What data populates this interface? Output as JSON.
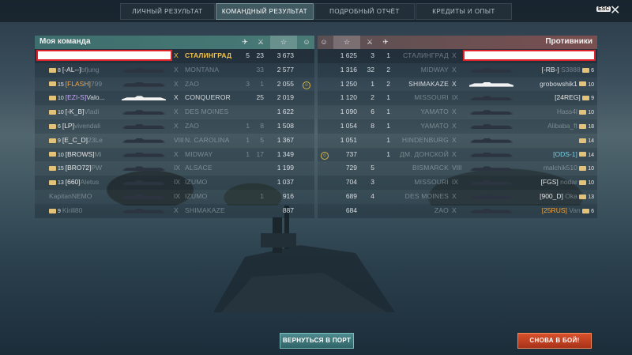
{
  "tabs": [
    {
      "label": "ЛИЧНЫЙ РЕЗУЛЬТАТ",
      "active": false
    },
    {
      "label": "КОМАНДНЫЙ РЕЗУЛЬТАТ",
      "active": true
    },
    {
      "label": "ПОДРОБНЫЙ ОТЧЁТ",
      "active": false
    },
    {
      "label": "КРЕДИТЫ И ОПЫТ",
      "active": false
    }
  ],
  "esc_label": "ESC",
  "close_glyph": "✕",
  "my_team": {
    "title": "Моя команда",
    "header_icons": [
      "plane-kill-icon",
      "ship-kill-icon",
      "star-icon",
      "medal-icon"
    ],
    "rows": [
      {
        "player": "",
        "clan": "",
        "tier": "X",
        "ship": "СТАЛИНГРАД",
        "planes": "5",
        "kills": "23",
        "xp": "3 673",
        "medal": "",
        "highlight": true,
        "alive": true
      },
      {
        "player": "bfjung",
        "clan": "[-AL--]",
        "clan_color": "white",
        "tier_badge": "8",
        "tier": "X",
        "ship": "MONTANA",
        "planes": "",
        "kills": "33",
        "xp": "2 577",
        "medal": "",
        "alive": false
      },
      {
        "player": "799",
        "clan": "[FLASH]",
        "clan_color": "orange",
        "tier_badge": "15",
        "tier": "X",
        "ship": "ZAO",
        "planes": "3",
        "kills": "1",
        "xp": "2 055",
        "medal": "medal",
        "alive": false
      },
      {
        "player": "Valo...",
        "clan": "[EZI-S]",
        "clan_color": "purple",
        "tier_badge": "10",
        "tier": "X",
        "ship": "CONQUEROR",
        "planes": "",
        "kills": "25",
        "xp": "2 019",
        "medal": "",
        "alive": true,
        "white_ship": true
      },
      {
        "player": "Vladi",
        "clan": "[-K_B]",
        "clan_color": "white",
        "tier_badge": "10",
        "tier": "X",
        "ship": "DES MOINES",
        "planes": "",
        "kills": "",
        "xp": "1 622",
        "medal": "",
        "alive": false
      },
      {
        "player": "vivendali",
        "clan": "[LP]",
        "clan_color": "white",
        "tier_badge": "6",
        "tier": "X",
        "ship": "ZAO",
        "planes": "1",
        "kills": "8",
        "xp": "1 508",
        "medal": "",
        "alive": false
      },
      {
        "player": "23Le",
        "clan": "[E_C_D]",
        "clan_color": "white",
        "tier_badge": "9",
        "tier": "VIII",
        "ship": "N. CAROLINA",
        "planes": "1",
        "kills": "5",
        "xp": "1 367",
        "medal": "",
        "alive": false
      },
      {
        "player": "Mi",
        "clan": "[BROWS]",
        "clan_color": "white",
        "tier_badge": "10",
        "tier": "X",
        "ship": "MIDWAY",
        "planes": "1",
        "kills": "17",
        "xp": "1 349",
        "medal": "",
        "alive": false
      },
      {
        "player": "PW",
        "clan": "[BRO72]",
        "clan_color": "white",
        "tier_badge": "15",
        "tier": "IX",
        "ship": "ALSACE",
        "planes": "",
        "kills": "",
        "xp": "1 199",
        "medal": "",
        "alive": false
      },
      {
        "player": "Aletus",
        "clan": "[660]",
        "clan_color": "white",
        "tier_badge": "13",
        "tier": "IX",
        "ship": "IZUMO",
        "planes": "",
        "kills": "",
        "xp": "1 037",
        "medal": "",
        "alive": false
      },
      {
        "player": "KapitanNEMO",
        "clan": "",
        "clan_color": "white",
        "tier_badge": "",
        "tier": "IX",
        "ship": "IZUMO",
        "planes": "",
        "kills": "1",
        "xp": "916",
        "medal": "",
        "alive": false
      },
      {
        "player": "Kirill80",
        "clan": "",
        "clan_color": "white",
        "tier_badge": "9",
        "tier": "X",
        "ship": "SHIMAKAZE",
        "planes": "",
        "kills": "",
        "xp": "887",
        "medal": "",
        "alive": false
      }
    ]
  },
  "enemy_team": {
    "title": "Противники",
    "header_icons": [
      "medal-icon",
      "star-icon",
      "ship-kill-icon",
      "plane-kill-icon"
    ],
    "rows": [
      {
        "player": "",
        "clan": "",
        "tier": "X",
        "ship": "СТАЛИНГРАД",
        "xp": "1 625",
        "kills": "3",
        "planes": "1",
        "medal": "",
        "highlight": true,
        "alive": false
      },
      {
        "player": "S3888",
        "clan": "[-RB-]",
        "clan_color": "white",
        "tier_badge": "6",
        "tier": "X",
        "ship": "MIDWAY",
        "xp": "1 316",
        "kills": "32",
        "planes": "2",
        "medal": "",
        "alive": false
      },
      {
        "player": "grobowshik1",
        "clan": "",
        "clan_color": "white",
        "tier_badge": "10",
        "tier": "X",
        "ship": "SHIMAKAZE",
        "xp": "1 250",
        "kills": "1",
        "planes": "2",
        "medal": "",
        "alive": true,
        "white_ship": true
      },
      {
        "player": "",
        "clan": "[24REG]",
        "clan_color": "white",
        "tier_badge": "9",
        "tier": "IX",
        "ship": "MISSOURI",
        "xp": "1 120",
        "kills": "2",
        "planes": "1",
        "medal": "",
        "alive": false
      },
      {
        "player": "Hass4l",
        "clan": "",
        "clan_color": "white",
        "tier_badge": "10",
        "tier": "X",
        "ship": "YAMATO",
        "xp": "1 090",
        "kills": "6",
        "planes": "1",
        "medal": "",
        "alive": false
      },
      {
        "player": "Alibaba_ft",
        "clan": "",
        "clan_color": "white",
        "tier_badge": "18",
        "tier": "X",
        "ship": "YAMATO",
        "xp": "1 054",
        "kills": "8",
        "planes": "1",
        "medal": "",
        "alive": false
      },
      {
        "player": "",
        "clan": "",
        "clan_color": "white",
        "tier_badge": "14",
        "tier": "X",
        "ship": "HINDENBURG",
        "xp": "1 051",
        "kills": "",
        "planes": "1",
        "medal": "",
        "alive": false
      },
      {
        "player": "",
        "clan": "[ODS-1]",
        "clan_color": "cyan",
        "tier_badge": "14",
        "tier": "X",
        "ship": "ДМ. ДОНСКОЙ",
        "xp": "737",
        "kills": "",
        "planes": "1",
        "medal": "medal",
        "alive": false
      },
      {
        "player": "malchik510",
        "clan": "",
        "clan_color": "white",
        "tier_badge": "10",
        "tier": "VIII",
        "ship": "BISMARCK",
        "xp": "729",
        "kills": "5",
        "planes": "",
        "medal": "",
        "alive": false
      },
      {
        "player": "nodar",
        "clan": "[FGS]",
        "clan_color": "white",
        "tier_badge": "10",
        "tier": "IX",
        "ship": "MISSOURI",
        "xp": "704",
        "kills": "3",
        "planes": "",
        "medal": "",
        "alive": false
      },
      {
        "player": "Oka",
        "clan": "[900_D]",
        "clan_color": "white",
        "tier_badge": "13",
        "tier": "X",
        "ship": "DES MOINES",
        "xp": "689",
        "kills": "4",
        "planes": "",
        "medal": "",
        "alive": false
      },
      {
        "player": "Van",
        "clan": "[25RUS]",
        "clan_color": "orange",
        "tier_badge": "6",
        "tier": "X",
        "ship": "ZAO",
        "xp": "684",
        "kills": "",
        "planes": "",
        "medal": "",
        "alive": false
      }
    ]
  },
  "buttons": {
    "port": "ВЕРНУТЬСЯ В ПОРТ",
    "again": "СНОВА В БОЙ!"
  },
  "colors": {
    "accent_teal": "#3d6e6d",
    "enemy_red": "#7a4f50",
    "highlight_border": "#e0222a",
    "gold": "#f1c24a",
    "again_button": "#d8502b"
  }
}
